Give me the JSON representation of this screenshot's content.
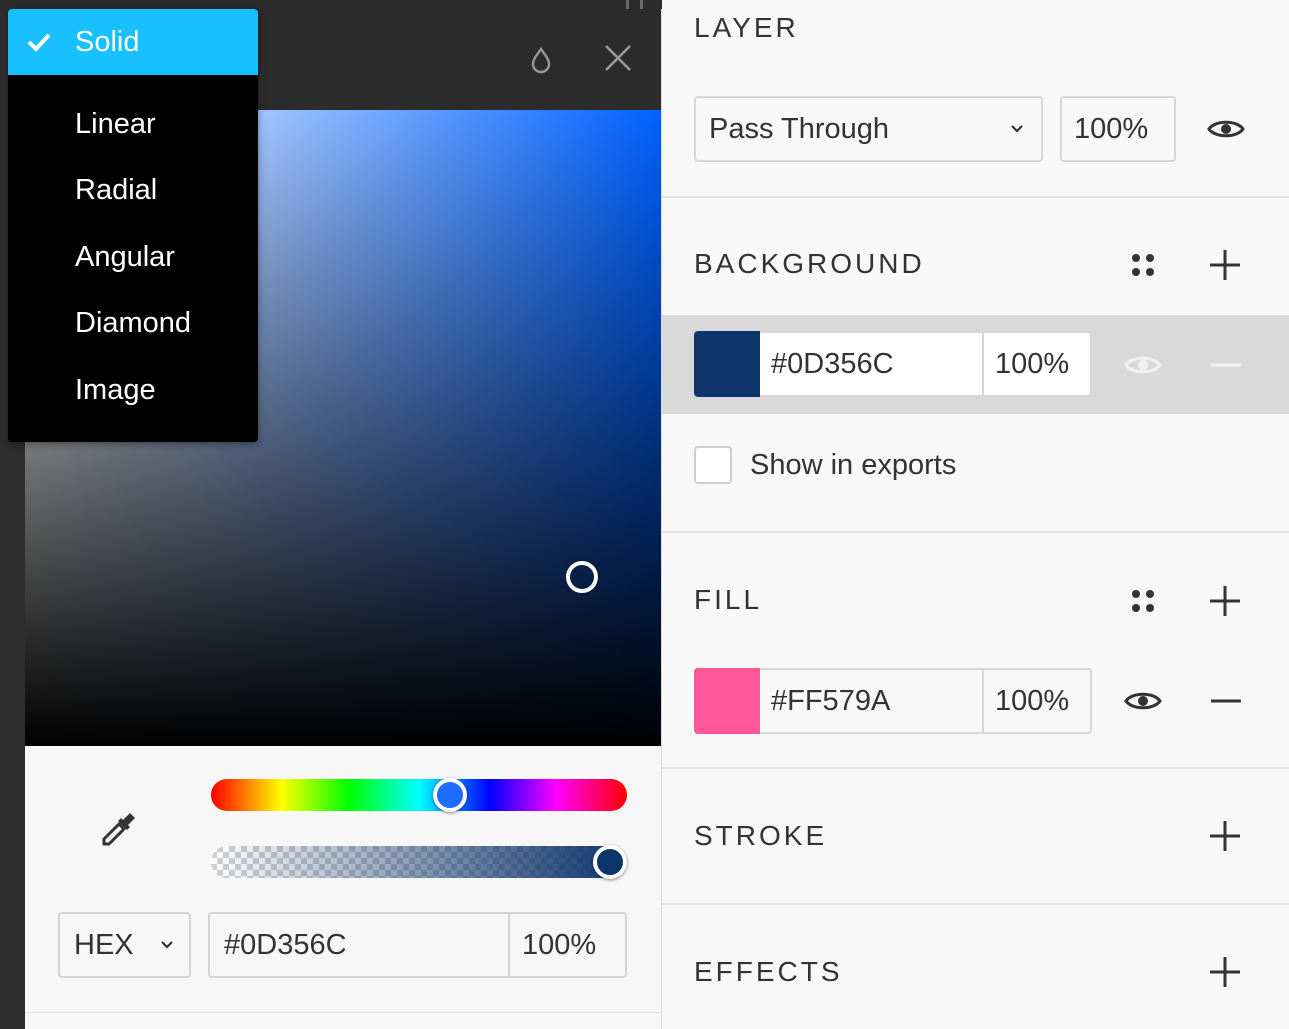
{
  "fill_type_menu": {
    "items": [
      {
        "label": "Solid",
        "selected": true
      },
      {
        "label": "Linear",
        "selected": false
      },
      {
        "label": "Radial",
        "selected": false
      },
      {
        "label": "Angular",
        "selected": false
      },
      {
        "label": "Diamond",
        "selected": false
      },
      {
        "label": "Image",
        "selected": false
      }
    ]
  },
  "picker": {
    "color_mode": "HEX",
    "hex_value": "#0D356C",
    "alpha_value": "100%",
    "hue_level": 0.58,
    "alpha_level": 1.0,
    "current_color": "#0D356C",
    "icons": {
      "header_left": "drop-icon",
      "header_right": "close-icon",
      "tool": "eyedropper-icon"
    }
  },
  "inspector": {
    "layer": {
      "title": "LAYER",
      "blend_mode": "Pass Through",
      "opacity": "100%"
    },
    "background": {
      "title": "BACKGROUND",
      "color": "#0D356C",
      "hex": "#0D356C",
      "opacity": "100%",
      "show_in_exports_label": "Show in exports",
      "show_in_exports": false
    },
    "fill": {
      "title": "FILL",
      "color": "#FF579A",
      "hex": "#FF579A",
      "opacity": "100%"
    },
    "stroke": {
      "title": "STROKE"
    },
    "effects": {
      "title": "EFFECTS"
    }
  },
  "colors": {
    "accent": "#18C0FF",
    "menu_background": "#000000",
    "header_background": "#2C2C2C"
  }
}
